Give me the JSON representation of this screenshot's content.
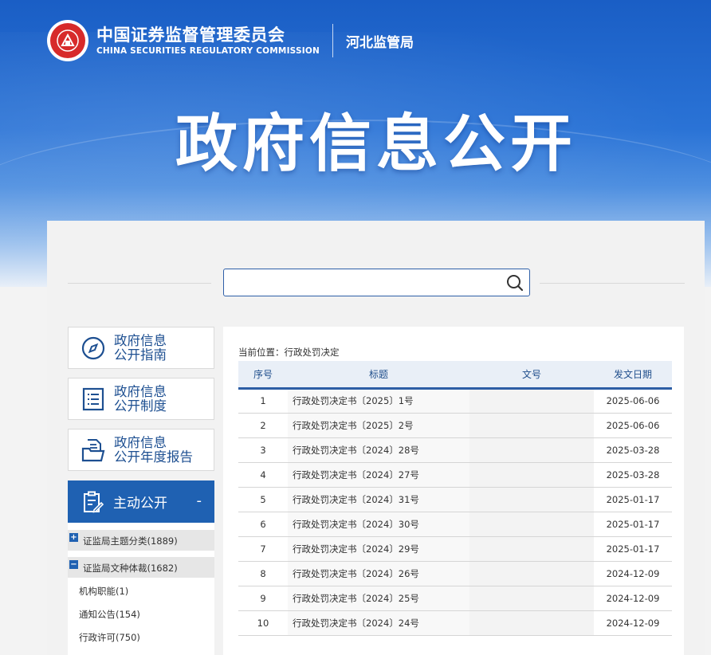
{
  "header": {
    "org_cn": "中国证券监督管理委员会",
    "org_en": "CHINA SECURITIES REGULATORY COMMISSION",
    "bureau": "河北监管局",
    "banner_title": "政府信息公开"
  },
  "search": {
    "placeholder": "",
    "value": ""
  },
  "sidebar": {
    "cards": [
      {
        "line1": "政府信息",
        "line2": "公开指南",
        "icon": "compass-icon"
      },
      {
        "line1": "政府信息",
        "line2": "公开制度",
        "icon": "list-document-icon"
      },
      {
        "line1": "政府信息",
        "line2": "公开年度报告",
        "icon": "folder-document-icon"
      }
    ],
    "active": {
      "label": "主动公开",
      "toggle": "-"
    },
    "categories": [
      {
        "toggle": "+",
        "label": "证监局主题分类(1889)"
      },
      {
        "toggle": "−",
        "label": "证监局文种体裁(1682)"
      }
    ],
    "leaves": [
      "机构职能(1)",
      "通知公告(154)",
      "行政许可(750)"
    ]
  },
  "content": {
    "breadcrumb": "当前位置：行政处罚决定",
    "columns": [
      "序号",
      "标题",
      "文号",
      "发文日期"
    ],
    "rows": [
      {
        "no": "1",
        "title": "行政处罚决定书〔2025〕1号",
        "doc": "",
        "date": "2025-06-06"
      },
      {
        "no": "2",
        "title": "行政处罚决定书〔2025〕2号",
        "doc": "",
        "date": "2025-06-06"
      },
      {
        "no": "3",
        "title": "行政处罚决定书〔2024〕28号",
        "doc": "",
        "date": "2025-03-28"
      },
      {
        "no": "4",
        "title": "行政处罚决定书〔2024〕27号",
        "doc": "",
        "date": "2025-03-28"
      },
      {
        "no": "5",
        "title": "行政处罚决定书〔2024〕31号",
        "doc": "",
        "date": "2025-01-17"
      },
      {
        "no": "6",
        "title": "行政处罚决定书〔2024〕30号",
        "doc": "",
        "date": "2025-01-17"
      },
      {
        "no": "7",
        "title": "行政处罚决定书〔2024〕29号",
        "doc": "",
        "date": "2025-01-17"
      },
      {
        "no": "8",
        "title": "行政处罚决定书〔2024〕26号",
        "doc": "",
        "date": "2024-12-09"
      },
      {
        "no": "9",
        "title": "行政处罚决定书〔2024〕25号",
        "doc": "",
        "date": "2024-12-09"
      },
      {
        "no": "10",
        "title": "行政处罚决定书〔2024〕24号",
        "doc": "",
        "date": "2024-12-09"
      }
    ]
  },
  "colors": {
    "brand_blue": "#1f61b2",
    "emblem_red": "#d72a2a",
    "table_rule": "#2d5ea5"
  }
}
